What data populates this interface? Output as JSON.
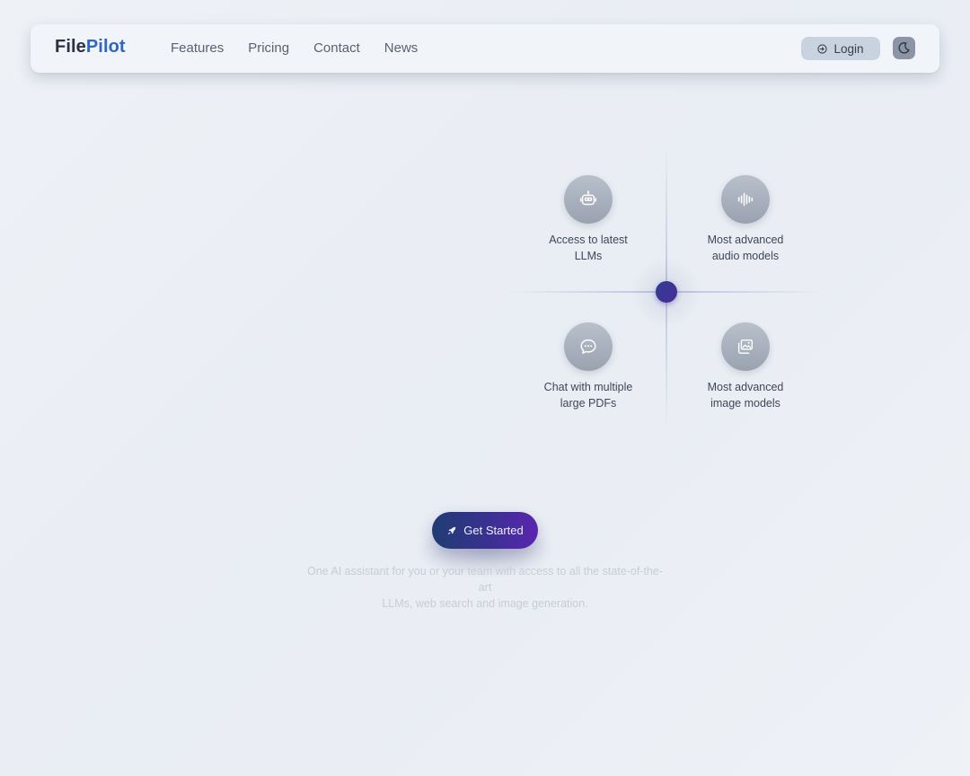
{
  "brand": {
    "part1": "File",
    "part2": "Pilot"
  },
  "nav": {
    "links": [
      "Features",
      "Pricing",
      "Contact",
      "News"
    ],
    "login_label": "Login",
    "login_icon": "login-icon",
    "theme_icon": "moon-icon"
  },
  "features": [
    {
      "label_line1": "Access to latest",
      "label_line2": "LLMs",
      "icon": "robot-icon"
    },
    {
      "label_line1": "Most advanced",
      "label_line2": "audio models",
      "icon": "audio-wave-icon"
    },
    {
      "label_line1": "Chat with multiple",
      "label_line2": "large PDFs",
      "icon": "chat-bubble-icon"
    },
    {
      "label_line1": "Most advanced",
      "label_line2": "image models",
      "icon": "images-icon"
    }
  ],
  "cta": {
    "label": "Get Started",
    "icon": "rocket-icon"
  },
  "subtitle": {
    "line1": "One AI assistant for you or your team with access to all the state-of-the-art",
    "line2": "LLMs, web search and image generation."
  },
  "colors": {
    "brand_accent": "#2e66c8",
    "cta_start": "#1f3d72",
    "cta_end": "#5a26b0",
    "center_dot": "#3a3592"
  }
}
